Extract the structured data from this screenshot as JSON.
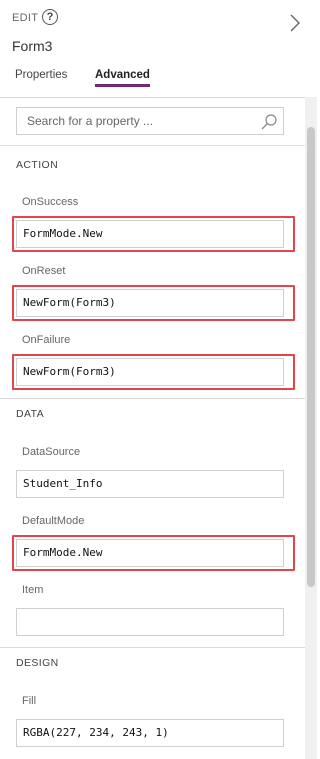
{
  "header": {
    "edit_label": "EDIT",
    "help_glyph": "?",
    "form_title": "Form3",
    "tabs": [
      {
        "label": "Properties",
        "active": false
      },
      {
        "label": "Advanced",
        "active": true
      }
    ],
    "accent_color": "#742774"
  },
  "search": {
    "placeholder": "Search for a property ..."
  },
  "sections": {
    "action": {
      "heading": "ACTION",
      "properties": [
        {
          "label": "OnSuccess",
          "value": "FormMode.New"
        },
        {
          "label": "OnReset",
          "value": "NewForm(Form3)"
        },
        {
          "label": "OnFailure",
          "value": "NewForm(Form3)"
        }
      ]
    },
    "data": {
      "heading": "DATA",
      "properties": [
        {
          "label": "DataSource",
          "value": "Student_Info"
        },
        {
          "label": "DefaultMode",
          "value": "FormMode.New"
        },
        {
          "label": "Item",
          "value": ""
        }
      ]
    },
    "design": {
      "heading": "DESIGN",
      "properties": [
        {
          "label": "Fill",
          "value": "RGBA(227, 234, 243, 1)"
        }
      ]
    }
  },
  "highlight_color": "#e0474c"
}
